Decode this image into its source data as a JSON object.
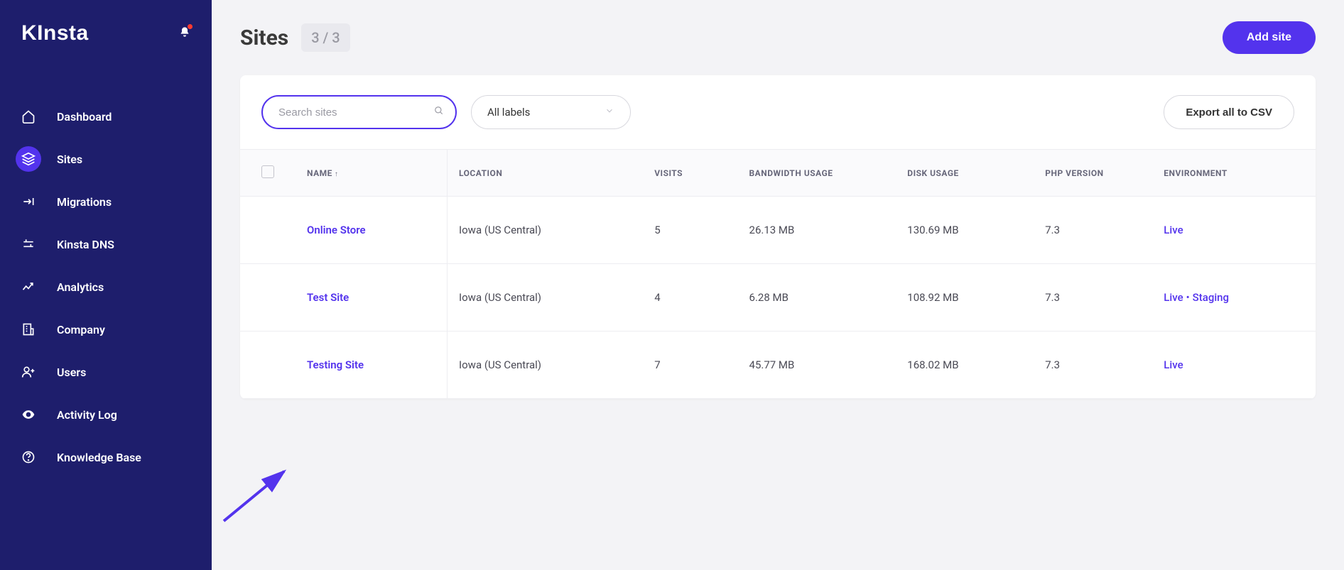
{
  "brand": "KInsta",
  "sidebar": {
    "items": [
      {
        "label": "Dashboard"
      },
      {
        "label": "Sites"
      },
      {
        "label": "Migrations"
      },
      {
        "label": "Kinsta DNS"
      },
      {
        "label": "Analytics"
      },
      {
        "label": "Company"
      },
      {
        "label": "Users"
      },
      {
        "label": "Activity Log"
      },
      {
        "label": "Knowledge Base"
      }
    ]
  },
  "header": {
    "title": "Sites",
    "count": "3 / 3",
    "add_label": "Add site"
  },
  "toolbar": {
    "search_placeholder": "Search sites",
    "labels_select": "All labels",
    "export_label": "Export all to CSV"
  },
  "table": {
    "columns": {
      "name": "NAME",
      "location": "LOCATION",
      "visits": "VISITS",
      "bandwidth": "BANDWIDTH USAGE",
      "disk": "DISK USAGE",
      "php": "PHP VERSION",
      "environment": "ENVIRONMENT"
    },
    "rows": [
      {
        "name": "Online Store",
        "location": "Iowa (US Central)",
        "visits": "5",
        "bandwidth": "26.13 MB",
        "disk": "130.69 MB",
        "php": "7.3",
        "env1": "Live",
        "env2": ""
      },
      {
        "name": "Test Site",
        "location": "Iowa (US Central)",
        "visits": "4",
        "bandwidth": "6.28 MB",
        "disk": "108.92 MB",
        "php": "7.3",
        "env1": "Live",
        "env2": "Staging"
      },
      {
        "name": "Testing Site",
        "location": "Iowa (US Central)",
        "visits": "7",
        "bandwidth": "45.77 MB",
        "disk": "168.02 MB",
        "php": "7.3",
        "env1": "Live",
        "env2": ""
      }
    ]
  }
}
